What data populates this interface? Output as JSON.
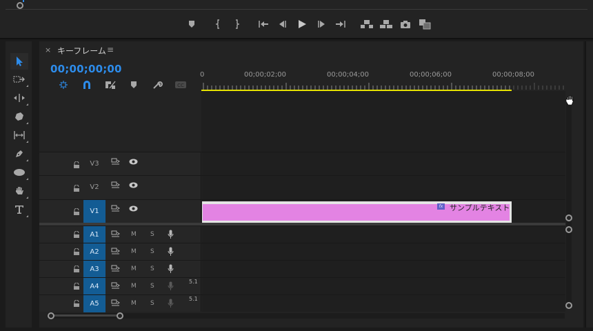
{
  "timeline": {
    "close_glyph": "×",
    "title": "キーフレーム",
    "menu_glyph": "≡",
    "timecode": "00;00;00;00",
    "ruler_labels": [
      "0",
      "00;00;02;00",
      "00;00;04;00",
      "00;00;06;00",
      "00;00;08;00"
    ],
    "video_tracks": [
      {
        "name": "V3",
        "targeted": false
      },
      {
        "name": "V2",
        "targeted": false
      },
      {
        "name": "V1",
        "targeted": true
      }
    ],
    "audio_tracks": [
      {
        "name": "A1",
        "mute": "M",
        "solo": "S",
        "channel": ""
      },
      {
        "name": "A2",
        "mute": "M",
        "solo": "S",
        "channel": ""
      },
      {
        "name": "A3",
        "mute": "M",
        "solo": "S",
        "channel": ""
      },
      {
        "name": "A4",
        "mute": "M",
        "solo": "S",
        "channel": "5.1"
      },
      {
        "name": "A5",
        "mute": "M",
        "solo": "S",
        "channel": "5.1"
      }
    ],
    "clip": {
      "label": "サンプルテキスト",
      "fx_badge": "fx",
      "color": "#e383e3"
    }
  },
  "colors": {
    "accent": "#2d8ceb",
    "target_track": "#135c94",
    "work_area": "#e5e100",
    "clip": "#e383e3"
  },
  "icons": {
    "transport": [
      "add-marker-icon",
      "mark-in-icon",
      "mark-out-icon",
      "go-to-in-icon",
      "step-back-icon",
      "play-icon",
      "step-forward-icon",
      "go-to-out-icon",
      "lift-icon",
      "extract-icon",
      "export-frame-icon",
      "compare-icon"
    ],
    "tools": [
      "selection-tool-icon",
      "track-select-tool-icon",
      "ripple-edit-tool-icon",
      "razor-tool-icon",
      "slip-tool-icon",
      "pen-tool-icon",
      "ellipse-tool-icon",
      "hand-tool-icon",
      "type-tool-icon"
    ],
    "timeline_tools": [
      "nest-sequence-icon",
      "snap-icon",
      "linked-selection-icon",
      "add-marker-icon",
      "timeline-settings-icon",
      "captions-icon"
    ]
  }
}
